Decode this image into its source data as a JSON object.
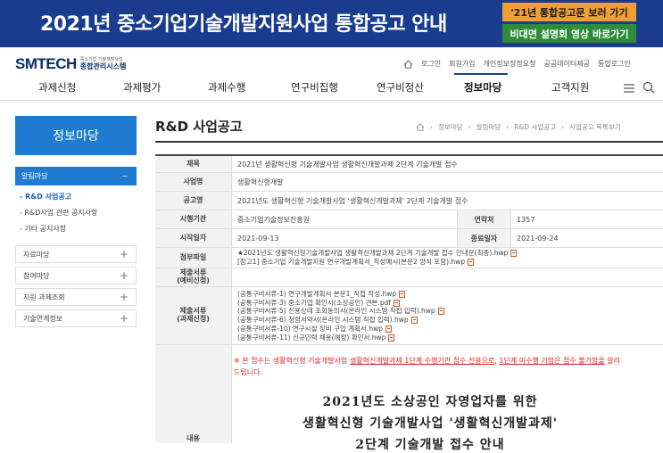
{
  "banner": {
    "title": "2021년 중소기업기술개발지원사업 통합공고 안내",
    "btn_notice": "'21년 통합공고문 보러 가기",
    "btn_video": "비대면 설명회 영상 바로가기"
  },
  "header": {
    "logo_main": "SMTECH",
    "logo_sub1": "중소기업 기술개발사업",
    "logo_sub2": "종합관리시스템",
    "util_links": [
      "로그인",
      "회원가입",
      "개인정보정정요청",
      "공공데이터제공",
      "통합로그인"
    ]
  },
  "gnb": [
    "과제신청",
    "과제평가",
    "과제수행",
    "연구비집행",
    "연구비정산",
    "정보마당",
    "고객지원"
  ],
  "sidebar": {
    "title": "정보마당",
    "group": "알림마당",
    "sub_items": [
      "- R&D 사업공고",
      "- R&D사업 관련 공지사항",
      "- 기타 공지사항"
    ],
    "items": [
      "자료마당",
      "참여마당",
      "지원 과제조회",
      "기술연계정보"
    ]
  },
  "content": {
    "title": "R&D 사업공고",
    "breadcrumb": [
      "정보마당",
      "알림마당",
      "R&D 사업공고",
      "사업공고 목록보기"
    ]
  },
  "detail": {
    "subject_label": "제목",
    "subject": "2021년 생활혁신형 기술개발사업 생활혁신개발과제 2단계 기술개발 접수",
    "program_label": "사업명",
    "program": "생활혁신형개발",
    "notice_label": "공고명",
    "notice": "2021년도 생활혁신형 기술개발사업 '생활혁신개발과제' 2단계 기술개발 접수",
    "agency_label": "시행기관",
    "agency": "중소기업기술정보진흥원",
    "contact_label": "연락처",
    "contact": "1357",
    "start_label": "시작일자",
    "start": "2021-09-13",
    "end_label": "종료일자",
    "end": "2021-09-24",
    "attach_label": "첨부파일",
    "attachments": [
      "★2021년도 생활혁신형기술개발사업 생활혁신개발과제 2단계 기술개발 접수 안내문(최종).hwp",
      "[참고1] 중소기업 기술개발지원 연구개발계획서_작성예시(본문2 양식 포함).hwp"
    ],
    "pre_docs_label": "제출서류\n(예비신청)",
    "docs_label": "제출서류\n(과제신청)",
    "docs": [
      "(공통구비서류-1) 연구개발계획서 본문1_직접 작성.hwp",
      "(공통구비서류-3) 중소기업 확인서(소상공인) 견본.pdf",
      "(공통구비서류-5) 신용상태 조회동의서(온라인 시스템 직접 입력).hwp",
      "(공통구비서류-6) 청렴서약서(온라인 시스템 직접 입력).hwp",
      "(공통구비서류-10) 연구시설 장비 구입 계획서.hwp",
      "(공통구비서류-11) 신규인력 채용(예정) 확인서.hwp"
    ],
    "content_label": "내용",
    "notice_text_1": "※ 본 접수는 생활혁신형 기술개발사업 ",
    "notice_text_u1": "생활혁신개발과제 1단계 수행기관 접수 전용으로",
    "notice_text_2": ", ",
    "notice_text_u2": "1단계 미수행 기업은 접수 불가함을",
    "notice_text_3": " 알려드립니다.",
    "big_line_1": "2021년도 소상공인 자영업자를 위한",
    "big_line_2": "생활혁신형 기술개발사업 '생활혁신개발과제'",
    "big_line_3": "2단계 기술개발 접수 안내"
  }
}
